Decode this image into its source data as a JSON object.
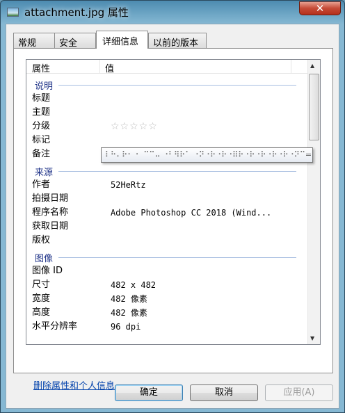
{
  "window": {
    "title": "attachment.jpg 属性",
    "close_label": "✕"
  },
  "tabs": [
    "常规",
    "安全",
    "详细信息",
    "以前的版本"
  ],
  "columns": {
    "property": "属性",
    "value": "值"
  },
  "groups": {
    "description": {
      "label": "说明",
      "rows": [
        {
          "name": "标题",
          "value": ""
        },
        {
          "name": "主题",
          "value": ""
        },
        {
          "name": "分级",
          "value": "☆☆☆☆☆"
        },
        {
          "name": "标记",
          "value": ""
        },
        {
          "name": "备注",
          "value": ""
        }
      ]
    },
    "origin": {
      "label": "来源",
      "rows": [
        {
          "name": "作者",
          "value": "52HeRtz"
        },
        {
          "name": "拍摄日期",
          "value": ""
        },
        {
          "name": "程序名称",
          "value": "Adobe Photoshop CC 2018 (Wind..."
        },
        {
          "name": "获取日期",
          "value": ""
        },
        {
          "name": "版权",
          "value": ""
        }
      ]
    },
    "image": {
      "label": "图像",
      "rows": [
        {
          "name": "图像 ID",
          "value": ""
        },
        {
          "name": "尺寸",
          "value": "482 x 482"
        },
        {
          "name": "宽度",
          "value": "482 像素"
        },
        {
          "name": "高度",
          "value": "482 像素"
        },
        {
          "name": "水平分辨率",
          "value": "96 dpi"
        }
      ]
    }
  },
  "rating_stars": 0,
  "tooltip": "⠇⠓⠄⠗⠂ ⠂ ⠉⠉⠤ ⠐⠃⠻⠗⠁ ⠐⠝⠐⠗⠐⠗⠐⠿⠗⠐⠗⠐⠗⠐⠗⠐⠗⠐⠝⠉=",
  "link": "删除属性和个人信息",
  "buttons": {
    "ok": "确定",
    "cancel": "取消",
    "apply": "应用(A)"
  }
}
